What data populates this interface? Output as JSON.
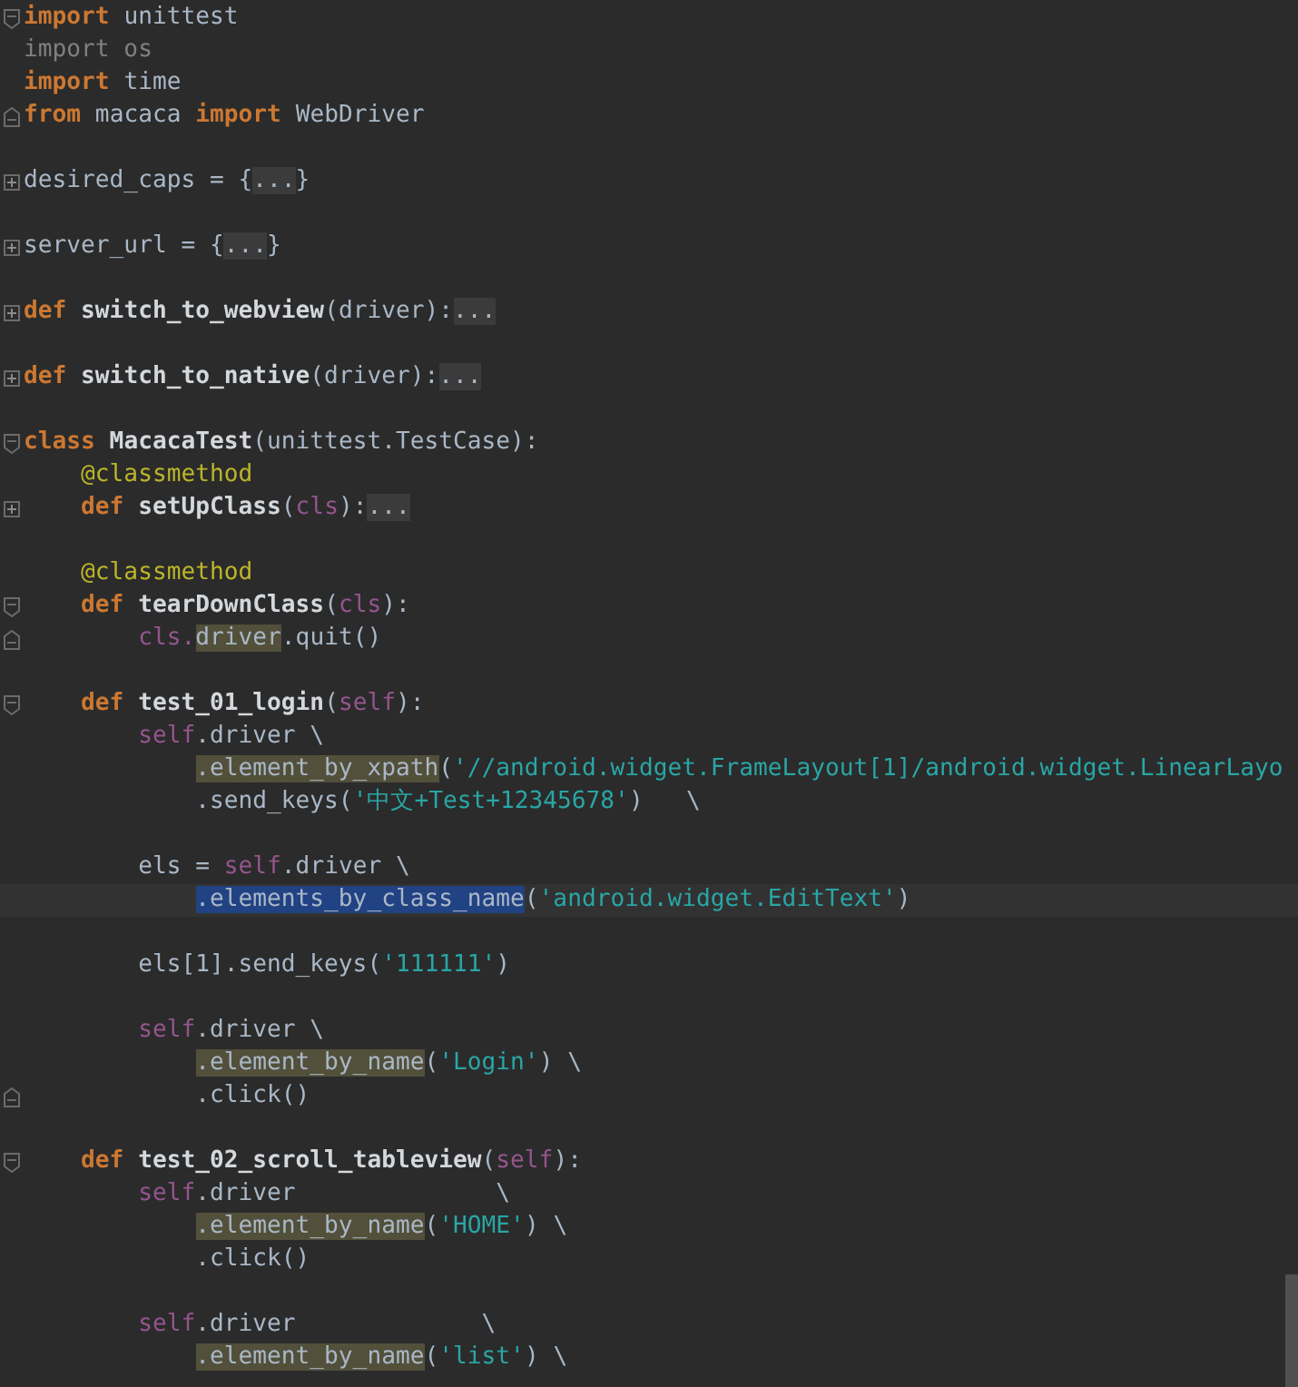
{
  "editor": {
    "lines": [
      {
        "kind": "code",
        "fold": {
          "kind": "open"
        },
        "tokens": [
          {
            "t": "import",
            "kind": "kw"
          },
          {
            "t": " unittest",
            "kind": "plain"
          }
        ]
      },
      {
        "kind": "code",
        "tokens": [
          {
            "t": "import os",
            "kind": "unused"
          }
        ]
      },
      {
        "kind": "code",
        "tokens": [
          {
            "t": "import",
            "kind": "kw"
          },
          {
            "t": " time",
            "kind": "plain"
          }
        ]
      },
      {
        "kind": "code",
        "fold": {
          "kind": "close"
        },
        "tokens": [
          {
            "t": "from",
            "kind": "kw"
          },
          {
            "t": " macaca ",
            "kind": "plain"
          },
          {
            "t": "import",
            "kind": "kw"
          },
          {
            "t": " WebDriver",
            "kind": "plain"
          }
        ]
      },
      {
        "kind": "blank"
      },
      {
        "kind": "code",
        "fold": {
          "kind": "collapsed"
        },
        "tokens": [
          {
            "t": "desired_caps = {",
            "kind": "plain"
          },
          {
            "t": "...",
            "kind": "folded"
          },
          {
            "t": "}",
            "kind": "plain"
          }
        ]
      },
      {
        "kind": "blank"
      },
      {
        "kind": "code",
        "fold": {
          "kind": "collapsed"
        },
        "tokens": [
          {
            "t": "server_url = {",
            "kind": "plain"
          },
          {
            "t": "...",
            "kind": "folded"
          },
          {
            "t": "}",
            "kind": "plain"
          }
        ]
      },
      {
        "kind": "blank"
      },
      {
        "kind": "code",
        "fold": {
          "kind": "collapsed"
        },
        "tokens": [
          {
            "t": "def",
            "kind": "kw"
          },
          {
            "t": " switch_to_webview",
            "kind": "name"
          },
          {
            "t": "(driver):",
            "kind": "plain"
          },
          {
            "t": "...",
            "kind": "folded"
          }
        ]
      },
      {
        "kind": "blank"
      },
      {
        "kind": "code",
        "fold": {
          "kind": "collapsed"
        },
        "tokens": [
          {
            "t": "def",
            "kind": "kw"
          },
          {
            "t": " switch_to_native",
            "kind": "name"
          },
          {
            "t": "(driver):",
            "kind": "plain"
          },
          {
            "t": "...",
            "kind": "folded"
          }
        ]
      },
      {
        "kind": "blank"
      },
      {
        "kind": "code",
        "fold": {
          "kind": "open"
        },
        "tokens": [
          {
            "t": "class",
            "kind": "kw"
          },
          {
            "t": " MacacaTest",
            "kind": "name"
          },
          {
            "t": "(unittest.TestCase):",
            "kind": "plain"
          }
        ],
        "children": [
          {
            "kind": "code",
            "tokens": [
              {
                "t": "@classmethod",
                "kind": "decorator"
              }
            ]
          },
          {
            "kind": "code",
            "fold": {
              "kind": "collapsed"
            },
            "tokens": [
              {
                "t": "def",
                "kind": "kw"
              },
              {
                "t": " setUpClass",
                "kind": "name"
              },
              {
                "t": "(",
                "kind": "plain"
              },
              {
                "t": "cls",
                "kind": "self"
              },
              {
                "t": "):",
                "kind": "plain"
              },
              {
                "t": "...",
                "kind": "folded"
              }
            ]
          },
          {
            "kind": "blank"
          },
          {
            "kind": "code",
            "tokens": [
              {
                "t": "@classmethod",
                "kind": "decorator"
              }
            ]
          },
          {
            "kind": "code",
            "fold": {
              "kind": "open"
            },
            "tokens": [
              {
                "t": "def",
                "kind": "kw"
              },
              {
                "t": " tearDownClass",
                "kind": "name"
              },
              {
                "t": "(",
                "kind": "plain"
              },
              {
                "t": "cls",
                "kind": "self"
              },
              {
                "t": "):",
                "kind": "plain"
              }
            ],
            "children": [
              {
                "kind": "code",
                "fold": {
                  "kind": "close"
                },
                "tokens": [
                  {
                    "t": "cls.",
                    "kind": "self"
                  },
                  {
                    "t": "driver",
                    "kind": "usage"
                  },
                  {
                    "t": ".quit()",
                    "kind": "plain"
                  }
                ]
              }
            ]
          },
          {
            "kind": "blank"
          },
          {
            "kind": "code",
            "fold": {
              "kind": "open"
            },
            "tokens": [
              {
                "t": "def",
                "kind": "kw"
              },
              {
                "t": " test_01_login",
                "kind": "name"
              },
              {
                "t": "(",
                "kind": "plain"
              },
              {
                "t": "self",
                "kind": "self"
              },
              {
                "t": "):",
                "kind": "plain"
              }
            ],
            "children": [
              {
                "kind": "code",
                "tokens": [
                  {
                    "t": "self",
                    "kind": "self"
                  },
                  {
                    "t": ".driver \\",
                    "kind": "plain"
                  }
                ],
                "children": [
                  {
                    "kind": "code",
                    "tokens": [
                      {
                        "t": ".element_by_xpath",
                        "kind": "usage"
                      },
                      {
                        "t": "(",
                        "kind": "plain"
                      },
                      {
                        "t": "'//android.widget.FrameLayout[1]/android.widget.LinearLayo",
                        "kind": "str"
                      }
                    ]
                  },
                  {
                    "kind": "code",
                    "tokens": [
                      {
                        "t": ".send_keys(",
                        "kind": "plain"
                      },
                      {
                        "t": "'中文+Test+12345678'",
                        "kind": "str"
                      },
                      {
                        "t": ")   \\",
                        "kind": "plain"
                      }
                    ]
                  }
                ]
              },
              {
                "kind": "blank"
              },
              {
                "kind": "code",
                "tokens": [
                  {
                    "t": "els = ",
                    "kind": "plain"
                  },
                  {
                    "t": "self",
                    "kind": "self"
                  },
                  {
                    "t": ".driver \\",
                    "kind": "plain"
                  }
                ],
                "children": [
                  {
                    "kind": "code",
                    "current": true,
                    "tokens": [
                      {
                        "t": ".elements_by_class_name",
                        "kind": "selection"
                      },
                      {
                        "t": "(",
                        "kind": "plain"
                      },
                      {
                        "t": "'android.widget.EditText'",
                        "kind": "str"
                      },
                      {
                        "t": ")",
                        "kind": "plain"
                      }
                    ]
                  }
                ]
              },
              {
                "kind": "blank"
              },
              {
                "kind": "code",
                "tokens": [
                  {
                    "t": "els[1].send_keys(",
                    "kind": "plain"
                  },
                  {
                    "t": "'111111'",
                    "kind": "str"
                  },
                  {
                    "t": ")",
                    "kind": "plain"
                  }
                ]
              },
              {
                "kind": "blank"
              },
              {
                "kind": "code",
                "tokens": [
                  {
                    "t": "self",
                    "kind": "self"
                  },
                  {
                    "t": ".driver \\",
                    "kind": "plain"
                  }
                ],
                "children": [
                  {
                    "kind": "code",
                    "tokens": [
                      {
                        "t": ".element_by_name",
                        "kind": "usage"
                      },
                      {
                        "t": "(",
                        "kind": "plain"
                      },
                      {
                        "t": "'Login'",
                        "kind": "str"
                      },
                      {
                        "t": ") \\",
                        "kind": "plain"
                      }
                    ]
                  },
                  {
                    "kind": "code",
                    "fold": {
                      "kind": "close"
                    },
                    "tokens": [
                      {
                        "t": ".click()",
                        "kind": "plain"
                      }
                    ]
                  }
                ]
              }
            ]
          },
          {
            "kind": "blank"
          },
          {
            "kind": "code",
            "fold": {
              "kind": "open"
            },
            "tokens": [
              {
                "t": "def",
                "kind": "kw"
              },
              {
                "t": " test_02_scroll_tableview",
                "kind": "name"
              },
              {
                "t": "(",
                "kind": "plain"
              },
              {
                "t": "self",
                "kind": "self"
              },
              {
                "t": "):",
                "kind": "plain"
              }
            ],
            "children": [
              {
                "kind": "code",
                "tokens": [
                  {
                    "t": "self",
                    "kind": "self"
                  },
                  {
                    "t": ".driver              \\",
                    "kind": "plain"
                  }
                ],
                "children": [
                  {
                    "kind": "code",
                    "tokens": [
                      {
                        "t": ".element_by_name",
                        "kind": "usage"
                      },
                      {
                        "t": "(",
                        "kind": "plain"
                      },
                      {
                        "t": "'HOME'",
                        "kind": "str"
                      },
                      {
                        "t": ") \\",
                        "kind": "plain"
                      }
                    ]
                  },
                  {
                    "kind": "code",
                    "tokens": [
                      {
                        "t": ".click()",
                        "kind": "plain"
                      }
                    ]
                  }
                ]
              },
              {
                "kind": "blank"
              },
              {
                "kind": "code",
                "tokens": [
                  {
                    "t": "self",
                    "kind": "self"
                  },
                  {
                    "t": ".driver             \\",
                    "kind": "plain"
                  }
                ],
                "children": [
                  {
                    "kind": "code",
                    "tokens": [
                      {
                        "t": ".element_by_name",
                        "kind": "usage"
                      },
                      {
                        "t": "(",
                        "kind": "plain"
                      },
                      {
                        "t": "'list'",
                        "kind": "str"
                      },
                      {
                        "t": ") \\",
                        "kind": "plain"
                      }
                    ]
                  }
                ]
              }
            ]
          }
        ]
      }
    ]
  }
}
